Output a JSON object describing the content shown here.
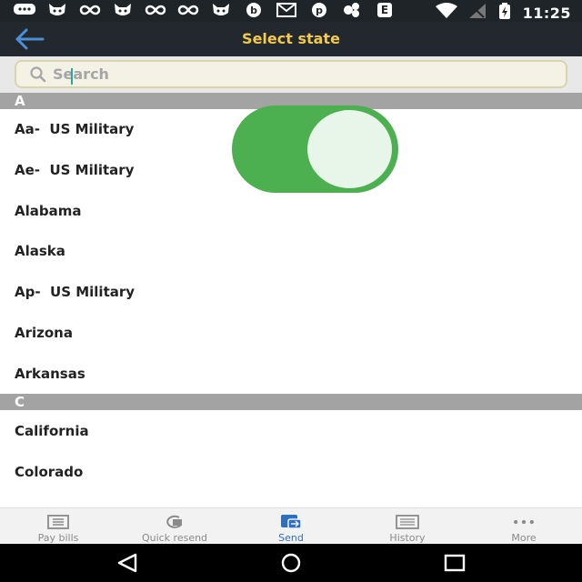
{
  "status_bar": {
    "time": "11:25",
    "notification_icons": [
      "chat-icon",
      "cat-icon",
      "infinity-icon",
      "cat-icon",
      "infinity-icon",
      "infinity-icon",
      "cat-icon",
      "b-icon",
      "mail-icon",
      "pinterest-icon",
      "clover-icon",
      "e-icon"
    ],
    "status_icons": [
      "wifi-icon",
      "no-signal-icon",
      "battery-charging-icon"
    ]
  },
  "app_bar": {
    "title": "Select state",
    "back_icon": "arrow-left-icon"
  },
  "search": {
    "placeholder": "Search",
    "value": ""
  },
  "sections": [
    {
      "header": "A",
      "items": [
        "Aa-  US Military",
        "Ae-  US Military",
        "Alabama",
        "Alaska",
        "Ap-  US Military",
        "Arizona",
        "Arkansas"
      ]
    },
    {
      "header": "C",
      "items": [
        "California",
        "Colorado"
      ]
    }
  ],
  "toggle": {
    "state": "on",
    "color": "#4caf50"
  },
  "bottom_nav": {
    "active": "Send",
    "items": [
      {
        "label": "Pay bills",
        "icon": "bill-icon"
      },
      {
        "label": "Quick resend",
        "icon": "resend-icon"
      },
      {
        "label": "Send",
        "icon": "send-icon"
      },
      {
        "label": "History",
        "icon": "history-icon"
      },
      {
        "label": "More",
        "icon": "more-dots-icon"
      }
    ]
  },
  "colors": {
    "title_yellow": "#f2c94c",
    "back_blue": "#4a90d9",
    "active_blue": "#2f6fbf",
    "header_gray": "#a3a3a3"
  }
}
